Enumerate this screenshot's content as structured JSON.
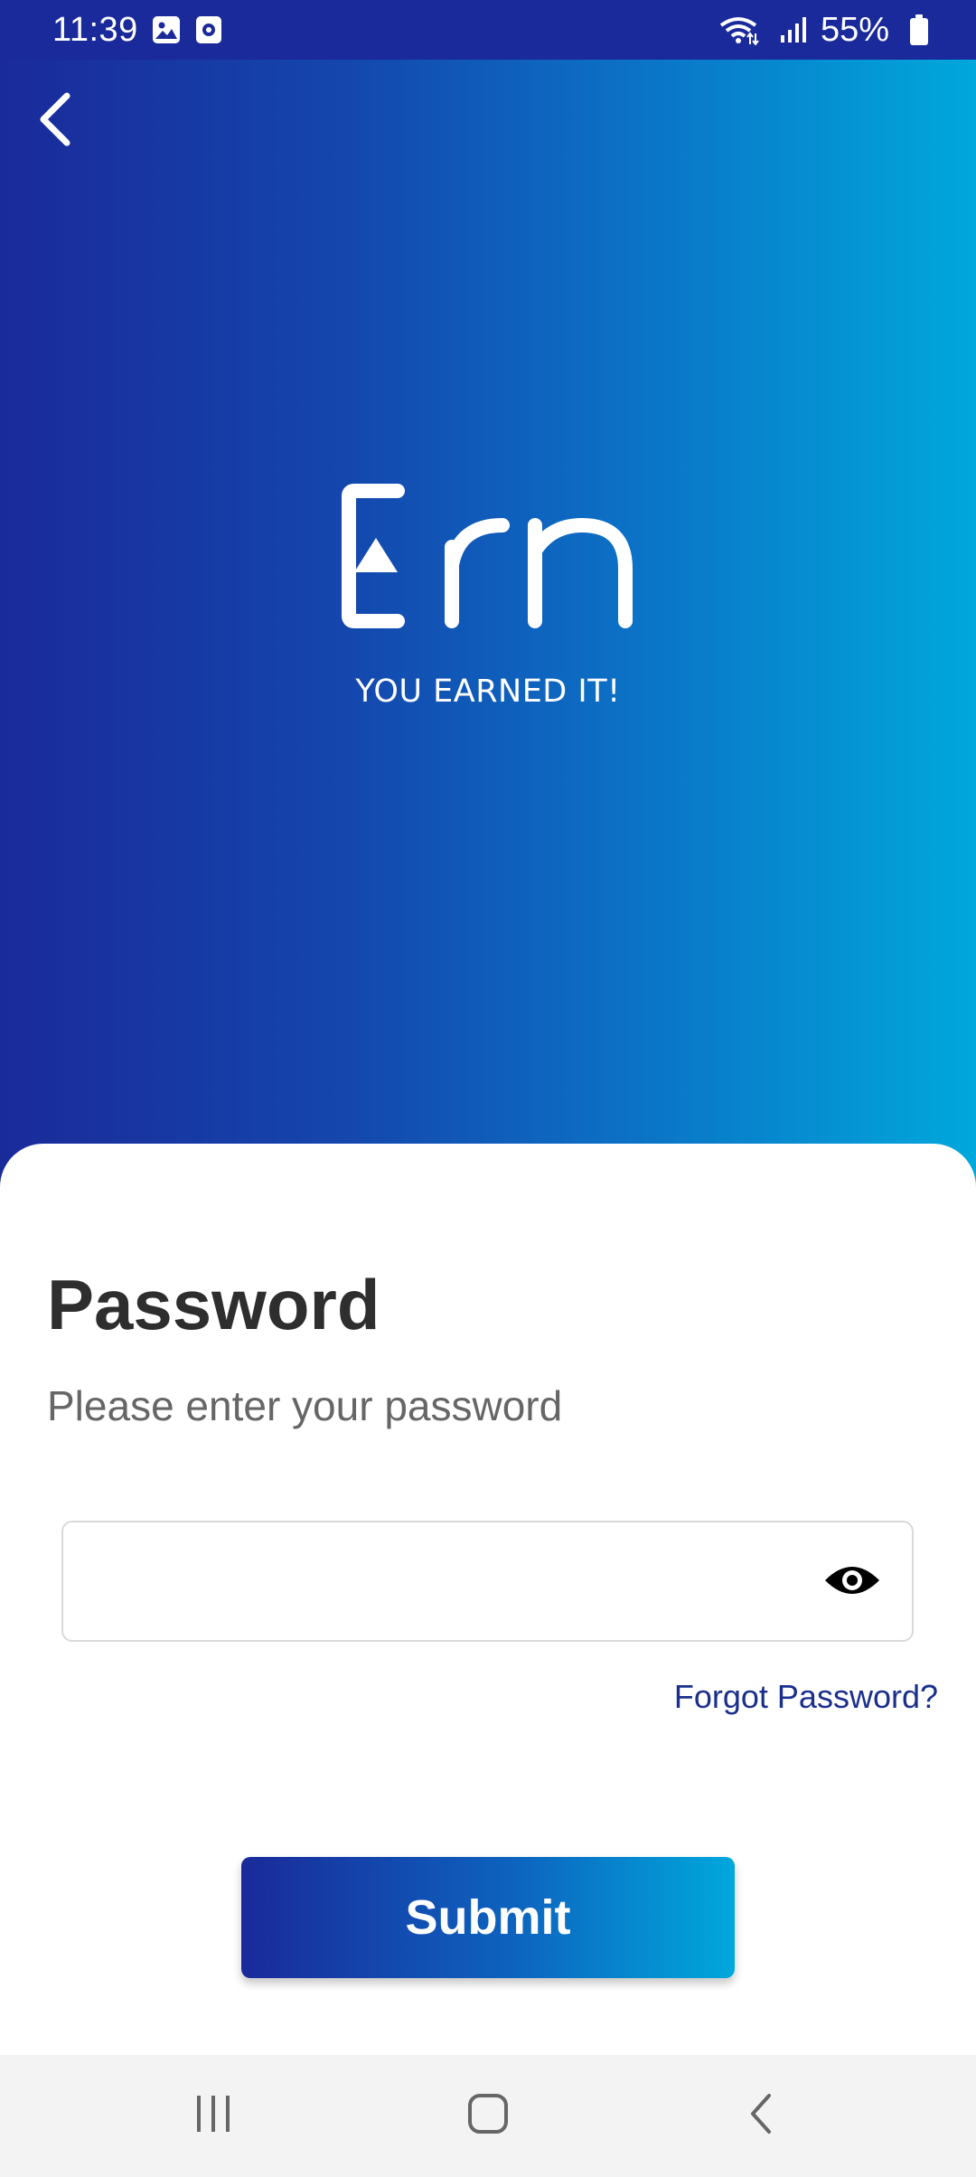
{
  "status_bar": {
    "time": "11:39",
    "battery": "55%",
    "icons": [
      "gallery-icon",
      "media-icon",
      "wifi-icon",
      "signal-icon",
      "battery-icon"
    ]
  },
  "header": {
    "back_icon": "chevron-left-icon",
    "logo_text": "Ern",
    "tagline": "YOU EARNED IT!"
  },
  "form": {
    "title": "Password",
    "subtitle": "Please enter your password",
    "password_value": "",
    "password_placeholder": "",
    "toggle_icon": "eye-icon",
    "forgot_label": "Forgot Password?",
    "submit_label": "Submit"
  },
  "nav": {
    "items": [
      "recent-apps-icon",
      "home-icon",
      "back-icon"
    ]
  },
  "colors": {
    "gradient_start": "#1a2a9a",
    "gradient_end": "#00a8dc",
    "link": "#1a2f8c",
    "title": "#2e2e2e",
    "subtitle": "#666666"
  }
}
